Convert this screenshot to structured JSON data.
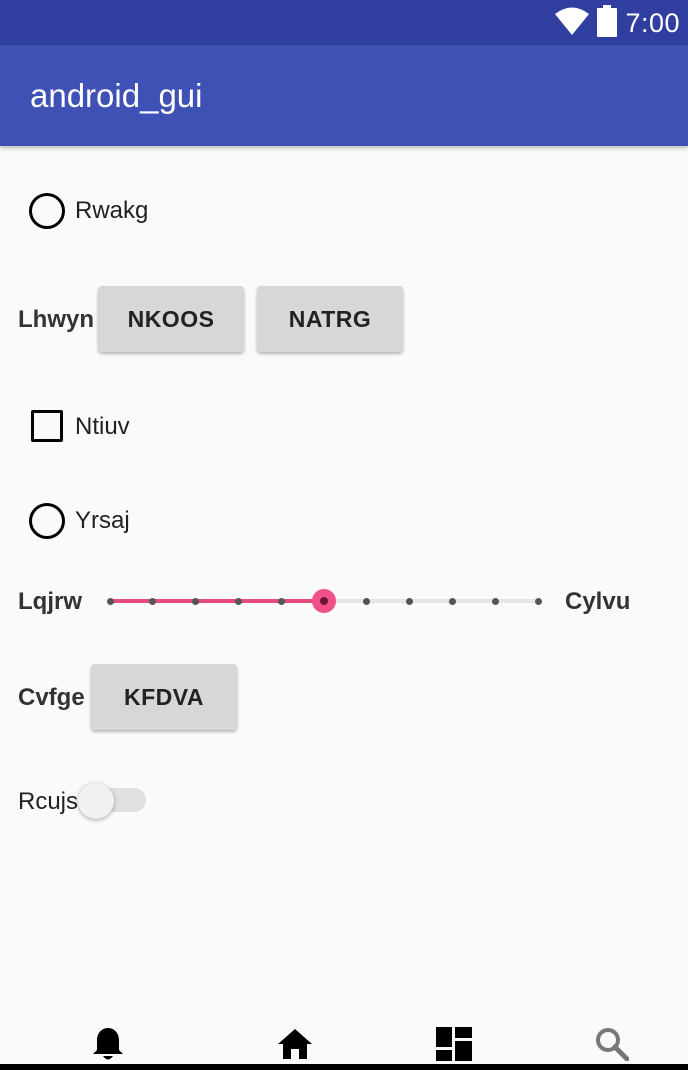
{
  "status_bar": {
    "time": "7:00",
    "icons": [
      "wifi-icon",
      "battery-icon"
    ]
  },
  "app_bar": {
    "title": "android_gui"
  },
  "controls": {
    "radio_1": {
      "label": "Rwakg",
      "checked": false
    },
    "row_lhwyn": {
      "label": "Lhwyn",
      "button_1": "NKOOS",
      "button_2": "NATRG"
    },
    "checkbox_1": {
      "label": "Ntiuv",
      "checked": false
    },
    "radio_2": {
      "label": "Yrsaj",
      "checked": false
    },
    "seekbar": {
      "label_left": "Lqjrw",
      "label_right": "Cylvu",
      "max": 10,
      "value": 5
    },
    "row_cvfge": {
      "label": "Cvfge",
      "button": "KFDVA"
    },
    "switch": {
      "label": "Rcujs",
      "on": false
    }
  },
  "bottom_nav": {
    "items": [
      "notifications-icon",
      "home-icon",
      "dashboard-icon",
      "search-icon"
    ]
  },
  "colors": {
    "status_bar": "#303f9f",
    "app_bar": "#3f51b5",
    "accent": "#ef5089",
    "background": "#fafafa",
    "button": "#d6d7d7"
  }
}
